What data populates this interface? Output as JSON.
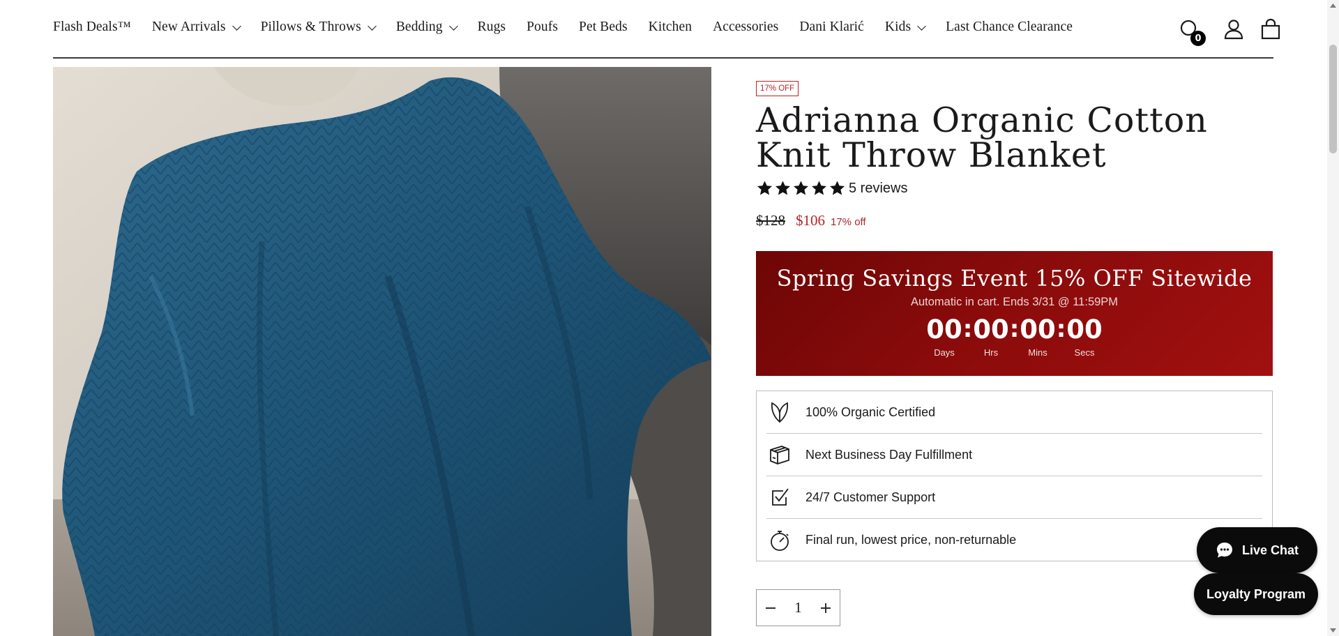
{
  "nav": {
    "items": [
      {
        "label": "Flash Deals™",
        "dropdown": false
      },
      {
        "label": "New Arrivals",
        "dropdown": true
      },
      {
        "label": "Pillows & Throws",
        "dropdown": true
      },
      {
        "label": "Bedding",
        "dropdown": true
      },
      {
        "label": "Rugs",
        "dropdown": false
      },
      {
        "label": "Poufs",
        "dropdown": false
      },
      {
        "label": "Pet Beds",
        "dropdown": false
      },
      {
        "label": "Kitchen",
        "dropdown": false
      },
      {
        "label": "Accessories",
        "dropdown": false
      },
      {
        "label": "Dani Klarić",
        "dropdown": false
      },
      {
        "label": "Kids",
        "dropdown": true
      },
      {
        "label": "Last Chance Clearance",
        "dropdown": false
      }
    ],
    "icons": [
      "search-icon",
      "account-icon",
      "cart-icon"
    ],
    "cart_count": "0"
  },
  "product": {
    "discount_tag": "17% OFF",
    "title": "Adrianna Organic Cotton Knit Throw Blanket",
    "rating": 5,
    "reviews": "5 reviews",
    "price_old": "$128",
    "price_new": "$106",
    "price_off": "17% off",
    "image_color": "#1e5577"
  },
  "promo": {
    "title": "Spring Savings Event 15% OFF Sitewide",
    "subtitle": "Automatic in cart. Ends 3/31 @ 11:59PM",
    "countdown": {
      "days": "00",
      "hrs": "00",
      "mins": "00",
      "secs": "00",
      "labels": {
        "days": "Days",
        "hrs": "Hrs",
        "mins": "Mins",
        "secs": "Secs"
      }
    },
    "bg_color": "#8a0b0b"
  },
  "features": [
    {
      "icon": "leaf-icon",
      "text": "100% Organic Certified"
    },
    {
      "icon": "box-icon",
      "text": "Next Business Day Fulfillment"
    },
    {
      "icon": "checkbox-icon",
      "text": "24/7 Customer Support"
    },
    {
      "icon": "stopwatch-icon",
      "text": "Final run, lowest price, non-returnable"
    }
  ],
  "quantity": {
    "value": "1"
  },
  "widgets": {
    "live_chat": "Live Chat",
    "loyalty": "Loyalty Program"
  },
  "colors": {
    "accent_red": "#b52424",
    "text": "#1a1a1a",
    "button_dark": "#0b0b0b"
  }
}
